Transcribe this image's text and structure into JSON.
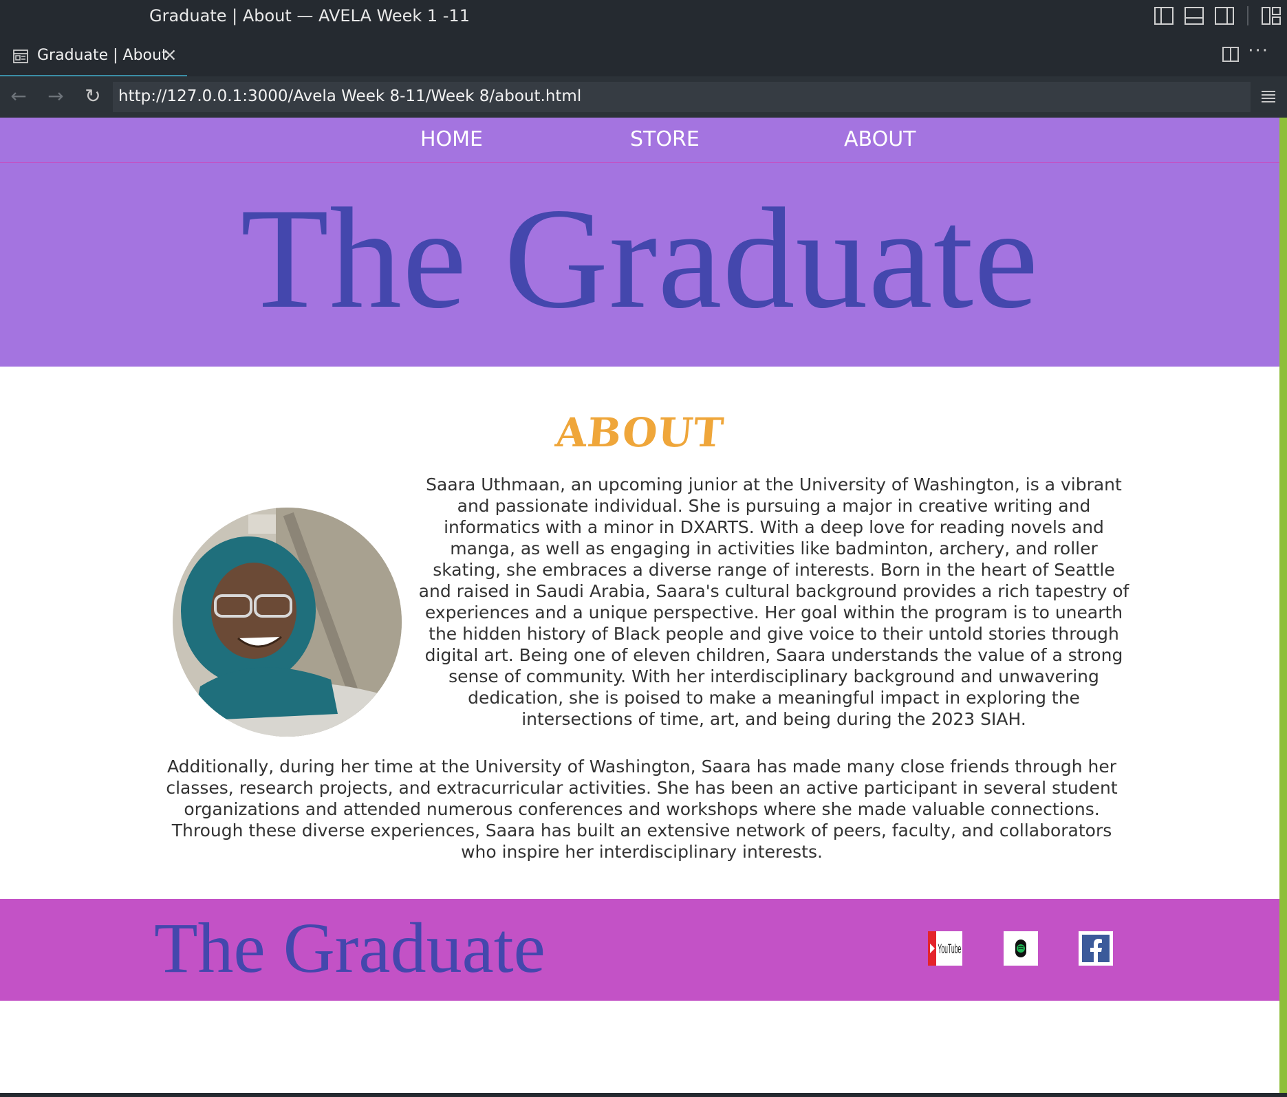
{
  "window": {
    "title": "Graduate | About — AVELA Week 1 -11"
  },
  "tab": {
    "label": "Graduate | About",
    "close": "×"
  },
  "addressbar": {
    "back": "←",
    "forward": "→",
    "reload": "↻",
    "url": "http://127.0.0.1:3000/Avela Week 8-11/Week 8/about.html"
  },
  "nav": {
    "home": "HOME",
    "store": "STORE",
    "about": "ABOUT"
  },
  "hero": {
    "title": "The Graduate"
  },
  "about": {
    "heading": "ABOUT",
    "intro": "Saara Uthmaan, an upcoming junior at the University of Washington, is a vibrant and passionate individual. She is pursuing a major in creative writing and informatics with a minor in DXARTS. With a deep love for reading novels and manga, as well as engaging in activities like badminton, archery, and roller skating, she embraces a diverse range of interests. Born in the heart of Seattle and raised in Saudi Arabia, Saara's cultural background provides a rich tapestry of experiences and a unique perspective. Her goal within the program is to unearth the hidden history of Black people and give voice to their untold stories through digital art. Being one of eleven children, Saara understands the value of a strong sense of community. With her interdisciplinary background and unwavering dedication, she is poised to make a meaningful impact in exploring the intersections of time, art, and being during the 2023 SIAH.",
    "additional": "Additionally, during her time at the University of Washington, Saara has made many close friends through her classes, research projects, and extracurricular activities. She has been an active participant in several student organizations and attended numerous conferences and workshops where she made valuable connections. Through these diverse experiences, Saara has built an extensive network of peers, faculty, and collaborators who inspire her interdisciplinary interests."
  },
  "footer": {
    "title": "The Graduate",
    "youtube_text": "YouTube"
  },
  "colors": {
    "header_bg": "#a474e0",
    "title_blue": "#4447ad",
    "about_orange": "#efa63a",
    "footer_bg": "#c352c6"
  }
}
